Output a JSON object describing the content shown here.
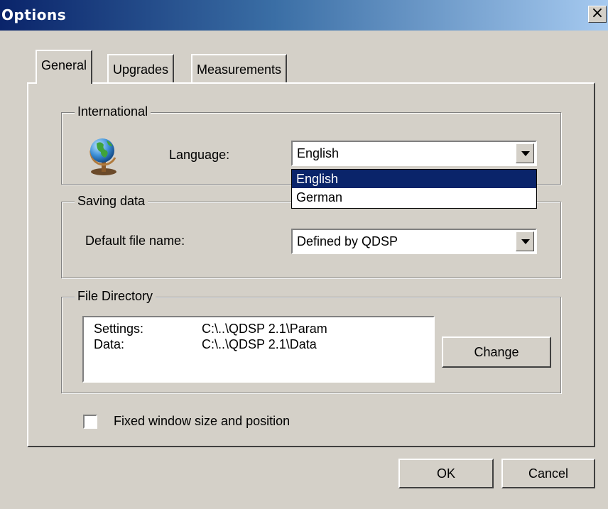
{
  "window": {
    "title": "Options",
    "close_symbol": "×"
  },
  "tabs": [
    {
      "label": "General",
      "active": true
    },
    {
      "label": "Upgrades",
      "active": false
    },
    {
      "label": "Measurements",
      "active": false
    }
  ],
  "international": {
    "group_label": "International",
    "icon": "globe-icon",
    "language_label": "Language:",
    "language_value": "English",
    "dropdown_options": [
      "English",
      "German"
    ],
    "highlighted_option": "English"
  },
  "saving_data": {
    "group_label": "Saving data",
    "default_file_name_label": "Default file name:",
    "default_file_name_value": "Defined by QDSP"
  },
  "file_directory": {
    "group_label": "File Directory",
    "rows": [
      {
        "label": "Settings:",
        "path": "C:\\..\\QDSP 2.1\\Param"
      },
      {
        "label": "Data:",
        "path": "C:\\..\\QDSP 2.1\\Data"
      }
    ],
    "change_label": "Change"
  },
  "fixed_window": {
    "label": "Fixed window size and position",
    "checked": false
  },
  "buttons": {
    "ok": "OK",
    "cancel": "Cancel"
  },
  "colors": {
    "title_start": "#0a246a",
    "title_end": "#a6caf0",
    "selection": "#0a246a",
    "face": "#d4d0c8"
  }
}
